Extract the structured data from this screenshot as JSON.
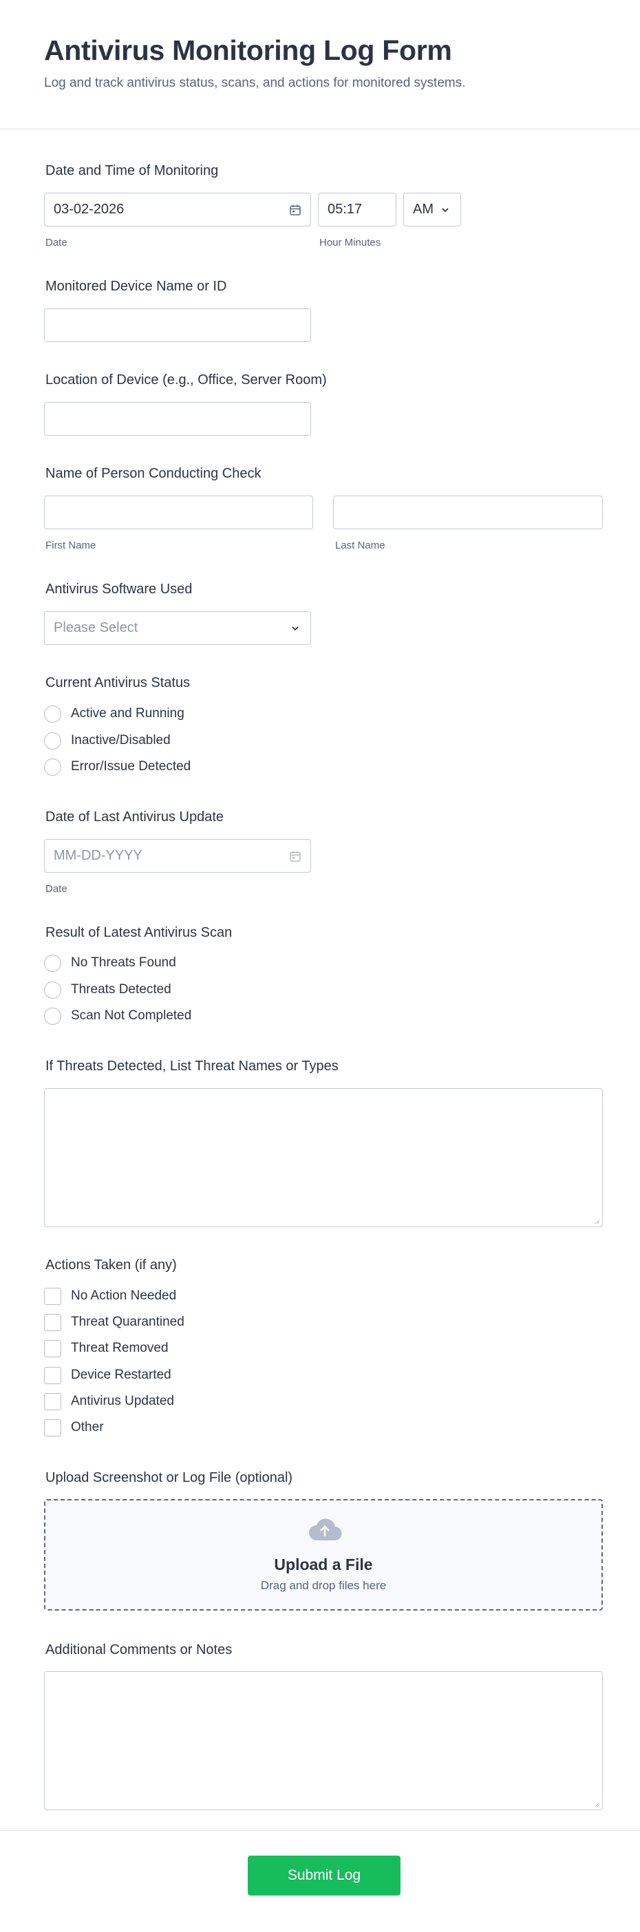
{
  "header": {
    "title": "Antivirus Monitoring Log Form",
    "subtitle": "Log and track antivirus status, scans, and actions for monitored systems."
  },
  "datetime": {
    "label": "Date and Time of Monitoring",
    "date_value": "03-02-2026",
    "time_value": "05:17",
    "ampm_value": "AM",
    "date_sublabel": "Date",
    "time_sublabel": "Hour Minutes"
  },
  "device": {
    "label": "Monitored Device Name or ID",
    "value": ""
  },
  "location": {
    "label": "Location of Device (e.g., Office, Server Room)",
    "value": ""
  },
  "person": {
    "label": "Name of Person Conducting Check",
    "first_sublabel": "First Name",
    "last_sublabel": "Last Name"
  },
  "software": {
    "label": "Antivirus Software Used",
    "placeholder": "Please Select"
  },
  "status": {
    "label": "Current Antivirus Status",
    "options": [
      "Active and Running",
      "Inactive/Disabled",
      "Error/Issue Detected"
    ]
  },
  "last_update": {
    "label": "Date of Last Antivirus Update",
    "placeholder": "MM-DD-YYYY",
    "sublabel": "Date"
  },
  "scan": {
    "label": "Result of Latest Antivirus Scan",
    "options": [
      "No Threats Found",
      "Threats Detected",
      "Scan Not Completed"
    ]
  },
  "threats": {
    "label": "If Threats Detected, List Threat Names or Types"
  },
  "actions": {
    "label": "Actions Taken (if any)",
    "options": [
      "No Action Needed",
      "Threat Quarantined",
      "Threat Removed",
      "Device Restarted",
      "Antivirus Updated",
      "Other"
    ]
  },
  "upload": {
    "label": "Upload Screenshot or Log File (optional)",
    "title": "Upload a File",
    "subtitle": "Drag and drop files here",
    "icon": "cloud-upload-icon"
  },
  "comments": {
    "label": "Additional Comments or Notes"
  },
  "submit": {
    "label": "Submit Log"
  },
  "colors": {
    "accent": "#18bd5b",
    "text": "#2c3345",
    "muted": "#57647e",
    "border": "#c3cad8"
  }
}
